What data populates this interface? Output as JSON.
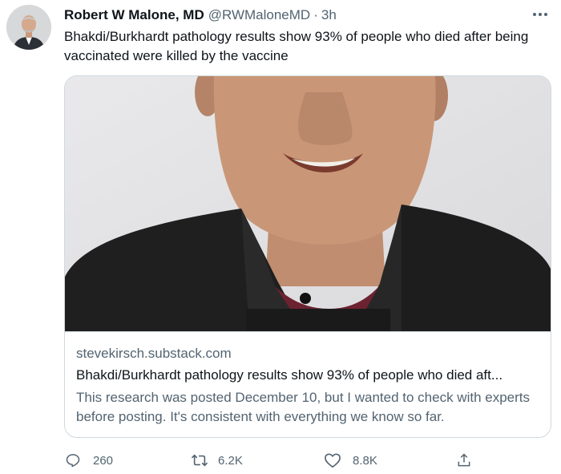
{
  "tweet": {
    "author_name": "Robert W Malone, MD",
    "author_handle": "@RWMaloneMD",
    "separator": "·",
    "time": "3h",
    "text": "Bhakdi/Burkhardt pathology results show 93% of people who died after being vaccinated were killed by the vaccine"
  },
  "card": {
    "domain": "stevekirsch.substack.com",
    "title": "Bhakdi/Burkhardt pathology results show 93% of people who died aft...",
    "description": "This research was posted December 10, but I wanted to check with experts before posting. It's consistent with everything we know so far."
  },
  "actions": {
    "reply": {
      "icon": "reply-icon",
      "count": "260"
    },
    "retweet": {
      "icon": "retweet-icon",
      "count": "6.2K"
    },
    "like": {
      "icon": "heart-icon",
      "count": "8.8K"
    },
    "share": {
      "icon": "share-icon"
    }
  },
  "colors": {
    "text": "#0f1419",
    "secondary": "#536471",
    "border": "#cfd9de"
  }
}
